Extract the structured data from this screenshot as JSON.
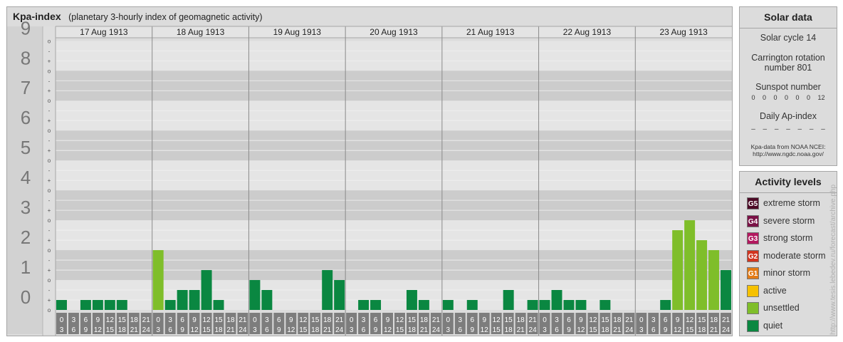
{
  "title": "Kpa-index",
  "subtitle": "(planetary 3-hourly index of geomagnetic activity)",
  "chart_data": {
    "type": "bar",
    "title": "Kpa-index",
    "subtitle": "(planetary 3-hourly index of geomagnetic activity)",
    "ylim": [
      0,
      9
    ],
    "y_ticks": [
      "0",
      "1",
      "2",
      "3",
      "4",
      "5",
      "6",
      "7",
      "8",
      "9"
    ],
    "minor_ticks": [
      "+",
      "o",
      "-"
    ],
    "days": [
      "17 Aug 1913",
      "18 Aug 1913",
      "19 Aug 1913",
      "20 Aug 1913",
      "21 Aug 1913",
      "22 Aug 1913",
      "23 Aug 1913"
    ],
    "interval_start": [
      "0",
      "3",
      "6",
      "9",
      "12",
      "15",
      "18",
      "21"
    ],
    "interval_end": [
      "3",
      "6",
      "9",
      "12",
      "15",
      "18",
      "21",
      "24"
    ],
    "values": [
      [
        0.333,
        0.0,
        0.333,
        0.333,
        0.333,
        0.333,
        0.0,
        0.0
      ],
      [
        2.0,
        0.333,
        0.667,
        0.667,
        1.333,
        0.333,
        0.0,
        0.0
      ],
      [
        1.0,
        0.667,
        0.0,
        0.0,
        0.0,
        0.0,
        1.333,
        1.0
      ],
      [
        0.0,
        0.333,
        0.333,
        0.0,
        0.0,
        0.667,
        0.333,
        0.0
      ],
      [
        0.333,
        0.0,
        0.333,
        0.0,
        0.0,
        0.667,
        0.0,
        0.333
      ],
      [
        0.333,
        0.667,
        0.333,
        0.333,
        0.0,
        0.333,
        0.0,
        0.0
      ],
      [
        0.0,
        0.0,
        0.333,
        2.667,
        3.0,
        2.333,
        2.0,
        1.333
      ]
    ],
    "colors": {
      "quiet": "#0a8741",
      "unsettled": "#7fbe2a"
    }
  },
  "solar": {
    "title": "Solar data",
    "cycle": "Solar cycle 14",
    "carrington_line1": "Carrington rotation",
    "carrington_line2": "number 801",
    "sunspot_label": "Sunspot number",
    "sunspot_values": "0 0 0 0 0 0 12",
    "ap_label": "Daily Ap-index",
    "ap_values": "– – – – – – –",
    "source_line1": "Kpa-data from NOAA NCEI:",
    "source_line2": "http://www.ngdc.noaa.gov/"
  },
  "activity": {
    "title": "Activity levels",
    "levels": [
      {
        "badge": "G5",
        "label": "extreme storm",
        "color": "#4d0a26"
      },
      {
        "badge": "G4",
        "label": "severe storm",
        "color": "#7a1246"
      },
      {
        "badge": "G3",
        "label": "strong storm",
        "color": "#b3195f"
      },
      {
        "badge": "G2",
        "label": "moderate storm",
        "color": "#d2351f"
      },
      {
        "badge": "G1",
        "label": "minor storm",
        "color": "#e37b16"
      },
      {
        "badge": "",
        "label": "active",
        "color": "#f6c100"
      },
      {
        "badge": "",
        "label": "unsettled",
        "color": "#7fbe2a"
      },
      {
        "badge": "",
        "label": "quiet",
        "color": "#0a8741"
      }
    ]
  },
  "watermark": "http://www.tesis.lebedev.ru/forecast/archive.php"
}
